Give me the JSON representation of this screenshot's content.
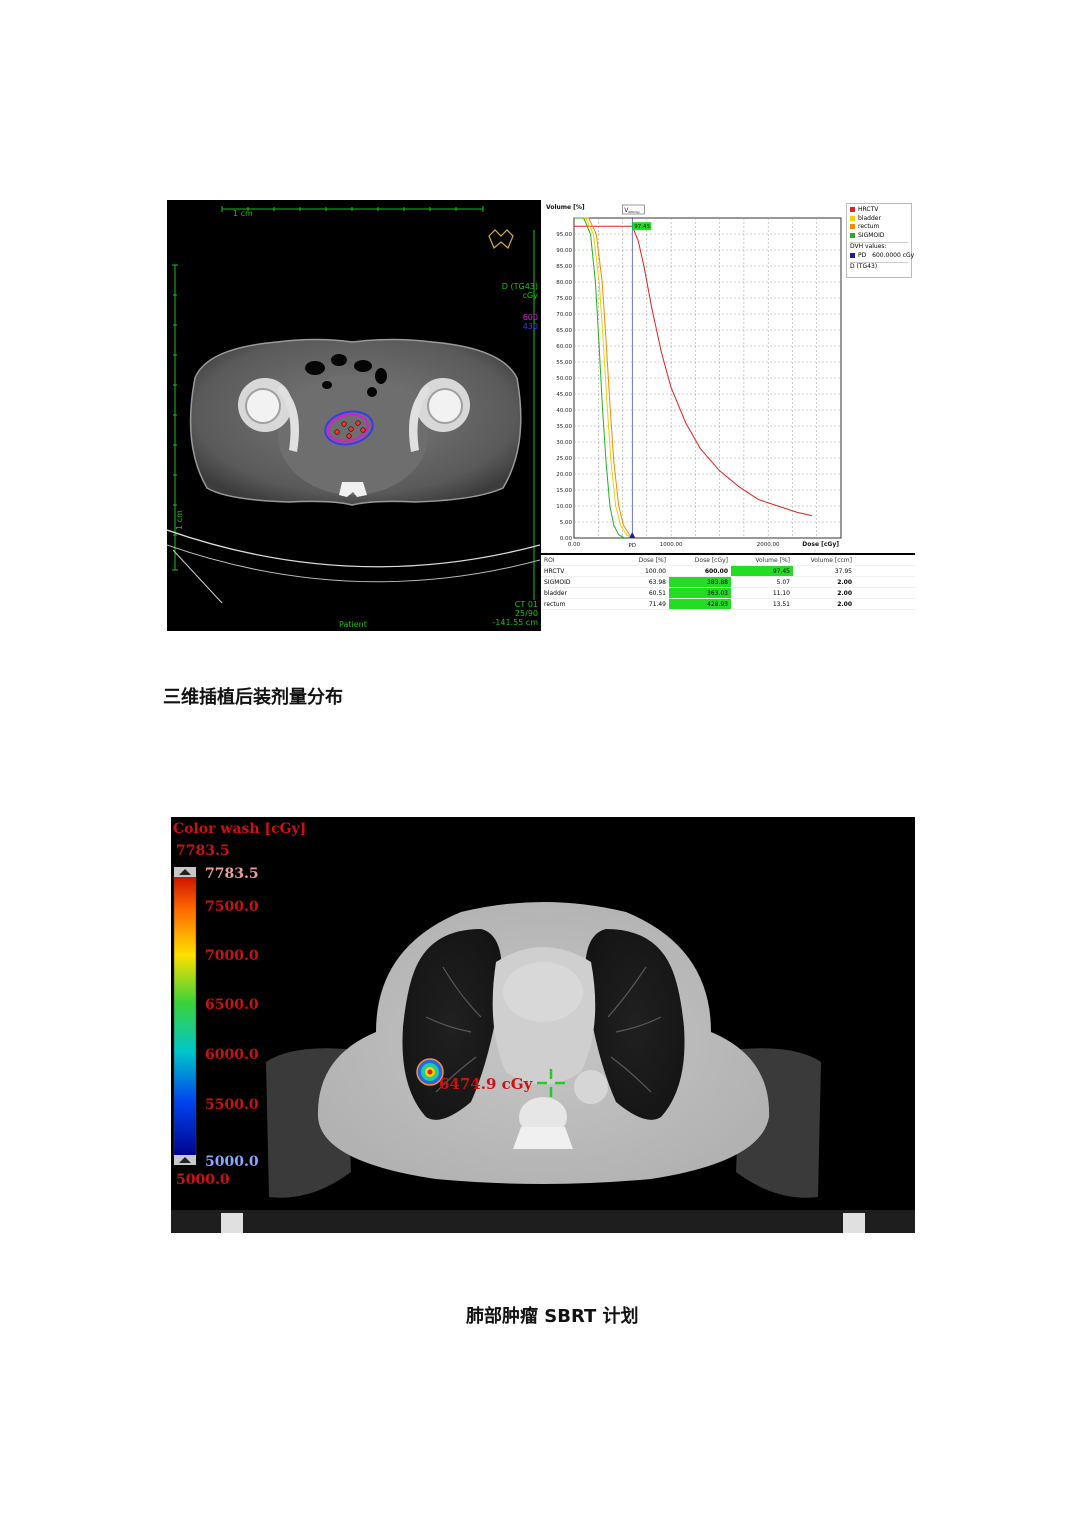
{
  "figure1": {
    "ct": {
      "scale_label": "1 cm",
      "vertical_scale_label": "1 cm",
      "dose_label_line1": "D (TG43)",
      "dose_label_line2": "cGy",
      "iso_value_1": "600",
      "iso_value_2": "430",
      "bottom_label": "Patient",
      "info_line1": "CT 01",
      "info_line2": "25/90",
      "info_line3": "-141.55 cm",
      "colors": {
        "iso_1": "#d21fd2",
        "iso_2": "#3a3af0",
        "overlay": "#17c217"
      }
    },
    "chart_data": {
      "type": "line",
      "title": "",
      "ylabel": "Volume [%]",
      "xlabel": "Dose [cGy]",
      "ylim": [
        0,
        100
      ],
      "xlim": [
        0,
        2750
      ],
      "yticks": [
        "0.00",
        "5.00",
        "10.00",
        "15.00",
        "20.00",
        "25.00",
        "30.00",
        "35.00",
        "40.00",
        "45.00",
        "50.00",
        "55.00",
        "60.00",
        "65.00",
        "70.00",
        "75.00",
        "80.00",
        "85.00",
        "90.00",
        "95.00"
      ],
      "xticks": [
        "0.00",
        "1000.00",
        "2000.00"
      ],
      "xtick_values": [
        0,
        1000,
        2000
      ],
      "marker_label": "PD",
      "marker_dose": 600,
      "v_label": "V",
      "v_sub": "600cGy",
      "v_value": "97.45",
      "series": [
        {
          "name": "HRCTV",
          "color": "#dd2222",
          "x": [
            0,
            600,
            660,
            720,
            800,
            900,
            1000,
            1150,
            1300,
            1500,
            1700,
            1900,
            2100,
            2300,
            2450
          ],
          "y": [
            97.45,
            97.45,
            93,
            85,
            72,
            58,
            47,
            36,
            28,
            21,
            16,
            12,
            10,
            8,
            7
          ]
        },
        {
          "name": "bladder",
          "color": "#f0d000",
          "x": [
            0,
            120,
            200,
            260,
            300,
            340,
            380,
            430,
            480,
            540,
            600
          ],
          "y": [
            100,
            100,
            95,
            80,
            62,
            42,
            24,
            10,
            4,
            1,
            0
          ]
        },
        {
          "name": "rectum",
          "color": "#f08c00",
          "x": [
            0,
            150,
            230,
            290,
            330,
            370,
            410,
            460,
            510,
            570,
            630
          ],
          "y": [
            100,
            100,
            95,
            80,
            62,
            42,
            24,
            10,
            4,
            1,
            0
          ]
        },
        {
          "name": "SIGMOID",
          "color": "#22b022",
          "x": [
            0,
            100,
            170,
            220,
            255,
            290,
            330,
            370,
            410,
            460,
            520
          ],
          "y": [
            100,
            100,
            95,
            80,
            62,
            42,
            24,
            10,
            4,
            1,
            0
          ]
        }
      ],
      "legend": {
        "items": [
          {
            "name": "HRCTV",
            "color": "#dd2222"
          },
          {
            "name": "bladder",
            "color": "#f0d000"
          },
          {
            "name": "rectum",
            "color": "#f08c00"
          },
          {
            "name": "SIGMOID",
            "color": "#22b022"
          }
        ],
        "dvh_values_label": "DVH values:",
        "pd_label": "PD",
        "pd_value": "600.0000 cGy",
        "pd_color": "#1a1aaa",
        "footer": "D (TG43)"
      }
    },
    "table": {
      "headers": [
        "ROI",
        "Dose [%]",
        "Dose [cGy]",
        "Volume [%]",
        "Volume [ccm]"
      ],
      "rows": [
        [
          "HRCTV",
          "100.00",
          "600.00",
          "97.45",
          "37.95"
        ],
        [
          "SIGMOID",
          "63.98",
          "383.88",
          "5.07",
          "2.00"
        ],
        [
          "bladder",
          "60.51",
          "363.03",
          "11.10",
          "2.00"
        ],
        [
          "rectum",
          "71.49",
          "428.93",
          "13.51",
          "2.00"
        ]
      ]
    }
  },
  "caption1": "三维插植后装剂量分布",
  "figure2": {
    "title": "Color wash [cGy]",
    "max_top": "7783.5",
    "scale_labels": [
      "7783.5",
      "7500.0",
      "7000.0",
      "6500.0",
      "6000.0",
      "5500.0",
      "5000.0"
    ],
    "min_bottom": "5000.0",
    "point_dose": "6474.9 cGy",
    "colors": {
      "label_red": "#cc1111",
      "scale_text": "#e8a0a0",
      "crosshair": "#22cc22"
    }
  },
  "caption2": "肺部肿瘤 SBRT 计划"
}
